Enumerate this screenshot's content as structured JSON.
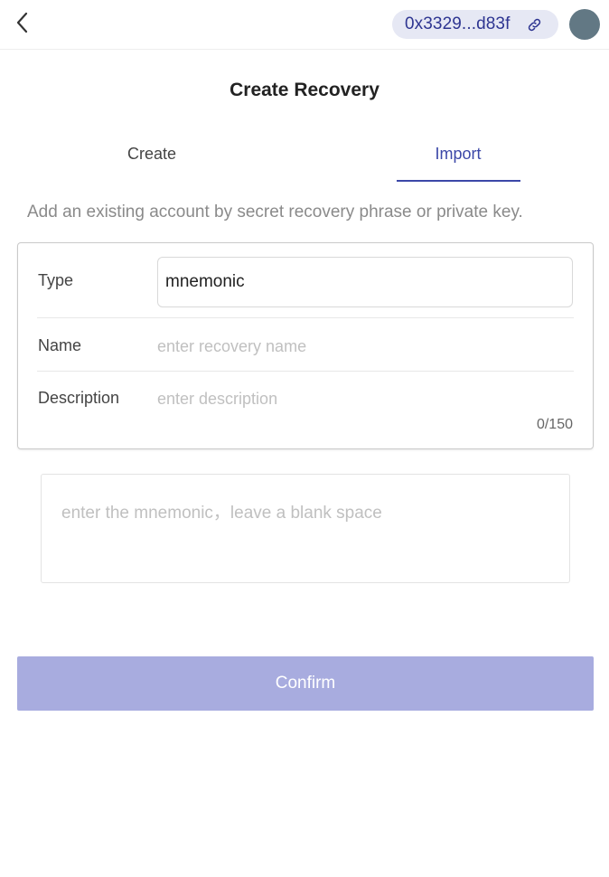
{
  "header": {
    "back_icon": "chevron-left-icon",
    "address": "0x3329...d83f",
    "link_icon": "link-icon",
    "avatar_color": "#627884"
  },
  "page": {
    "title": "Create Recovery"
  },
  "tabs": [
    {
      "label": "Create",
      "active": false
    },
    {
      "label": "Import",
      "active": true
    }
  ],
  "intro_text": "Add an existing account by secret recovery phrase or private key.",
  "form": {
    "type_label": "Type",
    "type_value": "mnemonic",
    "name_label": "Name",
    "name_placeholder": "enter recovery name",
    "description_label": "Description",
    "description_placeholder": "enter description",
    "char_count": "0/150"
  },
  "mnemonic_placeholder": "enter the mnemonic，leave a blank space",
  "confirm_label": "Confirm",
  "colors": {
    "accent": "#3c48a8",
    "address_pill_bg": "#e6e8f4",
    "confirm_disabled": "#a8acdf"
  }
}
